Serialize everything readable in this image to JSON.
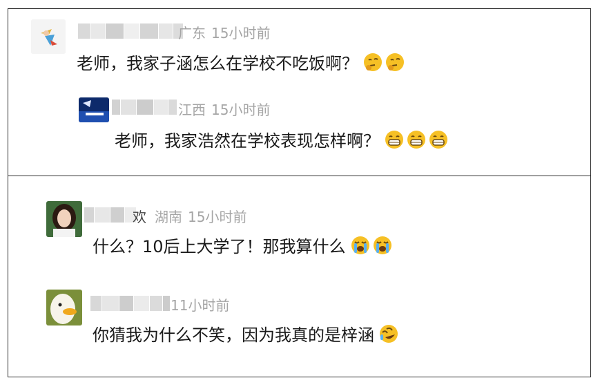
{
  "comments": [
    {
      "region": "广东",
      "time": "15小时前",
      "text": "老师，我家子涵怎么在学校不吃饭啊？",
      "emoji": [
        "thinking-face-icon",
        "thinking-face-icon"
      ]
    },
    {
      "region": "江西",
      "time": "15小时前",
      "text": "老师，我家浩然在学校表现怎样啊？",
      "emoji": [
        "grinning-face-icon",
        "grinning-face-icon",
        "grinning-face-icon"
      ]
    },
    {
      "name_tail": "欢",
      "region": "湖南",
      "time": "15小时前",
      "text": "什么？10后上大学了！那我算什么",
      "emoji": [
        "crying-face-icon",
        "crying-face-icon"
      ]
    },
    {
      "region": "",
      "time": "11小时前",
      "text": "你猜我为什么不笑，因为我真的是梓涵",
      "emoji": [
        "rolling-laugh-icon"
      ]
    }
  ],
  "colors": {
    "meta": "#a5a5a5",
    "text": "#1a1a1a",
    "emoji_yellow": "#f6c025"
  }
}
